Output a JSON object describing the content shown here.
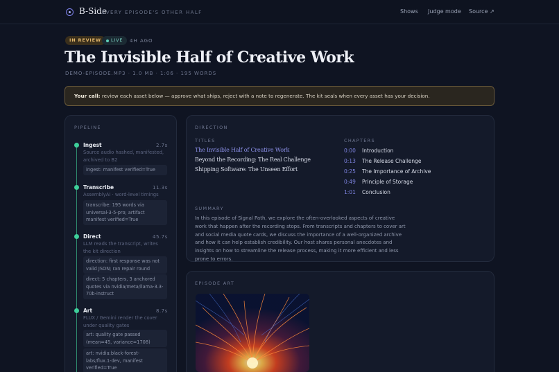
{
  "header": {
    "brand": "B-Side",
    "tagline": "EVERY EPISODE'S OTHER HALF",
    "nav": [
      {
        "label": "Shows"
      },
      {
        "label": "Judge mode"
      },
      {
        "label": "Source ↗"
      }
    ]
  },
  "episode": {
    "status_badge": "IN REVIEW",
    "live_badge": "LIVE",
    "time_ago": "4H AGO",
    "title": "The Invisible Half of Creative Work",
    "file_meta": "DEMO-EPISODE.MP3 · 1.0 MB · 1:06 · 195 WORDS"
  },
  "callout": {
    "lead": "Your call:",
    "text": " review each asset below — approve what ships, reject with a note to regenerate. The kit seals when every asset has your decision."
  },
  "pipeline": {
    "label": "PIPELINE",
    "steps": [
      {
        "name": "Ingest",
        "time": "2.7s",
        "desc": "Source audio hashed, manifested, archived to B2",
        "logs": [
          "ingest: manifest verified=True"
        ]
      },
      {
        "name": "Transcribe",
        "time": "11.3s",
        "desc": "AssemblyAI · word-level timings",
        "logs": [
          "transcribe: 195 words via universal-3-5-pro; artifact manifest verified=True"
        ]
      },
      {
        "name": "Direct",
        "time": "45.7s",
        "desc": "LLM reads the transcript, writes the kit direction",
        "logs": [
          "direction: first response was not valid JSON; ran repair round",
          "direct: 5 chapters, 3 anchored quotes via nvidia/meta/llama-3.3-70b-instruct"
        ]
      },
      {
        "name": "Art",
        "time": "8.7s",
        "desc": "FLUX / Gemini render the cover under quality gates",
        "logs": [
          "art: quality gate passed (mean=45, variance=1708)",
          "art: nvidia:black-forest-labs/flux.1-dev, manifest verified=True"
        ]
      }
    ]
  },
  "direction": {
    "label": "DIRECTION",
    "titles_label": "TITLES",
    "titles": [
      "The Invisible Half of Creative Work",
      "Beyond the Recording: The Real Challenge",
      "Shipping Software: The Unseen Effort"
    ],
    "chapters_label": "CHAPTERS",
    "chapters": [
      {
        "time": "0:00",
        "title": "Introduction"
      },
      {
        "time": "0:13",
        "title": "The Release Challenge"
      },
      {
        "time": "0:25",
        "title": "The Importance of Archive"
      },
      {
        "time": "0:49",
        "title": "Principle of Storage"
      },
      {
        "time": "1:01",
        "title": "Conclusion"
      }
    ],
    "summary_label": "SUMMARY",
    "summary": "In this episode of Signal Path, we explore the often-overlooked aspects of creative work that happen after the recording stops. From transcripts and chapters to cover art and social media quote cards, we discuss the importance of a well-organized archive and how it can help establish credibility. Our host shares personal anecdotes and insights on how to streamline the release process, making it more efficient and less prone to errors."
  },
  "episode_art": {
    "label": "EPISODE ART"
  },
  "colors": {
    "accent": "#7c82de",
    "success": "#3ecf9a",
    "warning": "#e0b56a",
    "background": "#0f1422"
  }
}
